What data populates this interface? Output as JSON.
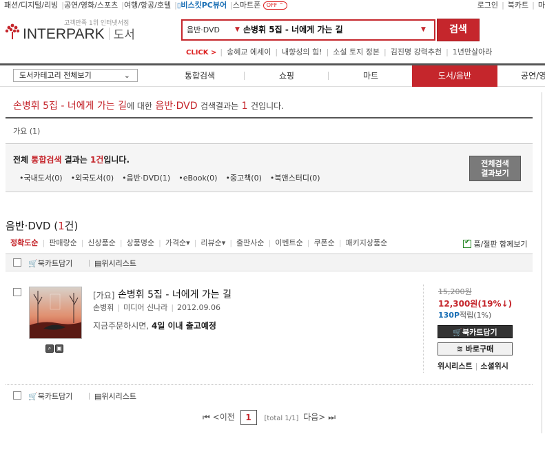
{
  "top_util": {
    "left_links": [
      "패션/디지털/리빙",
      "공연/영화/스포츠",
      "여행/항공/호텔"
    ],
    "biz_pc": "비스킷PC뷰어",
    "smart": "스마트폰",
    "off_badge": "OFF ⌃",
    "right_links": [
      "로그인",
      "북카트",
      "마"
    ]
  },
  "logo": {
    "tagline": "고객만족 1위 인터넷서점",
    "brand": "INTERPARK",
    "section": "도서"
  },
  "search": {
    "category": "음반·DVD",
    "query": "손병휘 5집 - 너에게 가는 길",
    "button": "검색"
  },
  "click_row": {
    "label": "CLICK >",
    "items": [
      "송혜교 에세이",
      "내향성의 힘!",
      "소설 토지 정본",
      "김진명 강력추천",
      "1년만살아라"
    ]
  },
  "gnb": {
    "category_select": "도서카테고리 전체보기",
    "tabs": [
      "통합검색",
      "쇼핑",
      "마트",
      "도서/음반",
      "공연/영"
    ],
    "active_tab": "도서/음반"
  },
  "result": {
    "query": "손병휘 5집 - 너에게 가는 길",
    "mid": "에 대한",
    "category": "음반·DVD",
    "tail1": "검색결과는",
    "count": "1",
    "tail2": "건입니다."
  },
  "genre_filter": "가요 (1)",
  "total": {
    "pre": "전체",
    "highlight": "통합검색",
    "mid": "결과는",
    "count": "1건",
    "post": "입니다.",
    "links": [
      "•국내도서(0)",
      "•외국도서(0)",
      "•음반·DVD(1)",
      "•eBook(0)",
      "•중고책(0)",
      "•북앤스터디(0)"
    ],
    "button_line1": "전체검색",
    "button_line2": "결과보기"
  },
  "section": {
    "title": "음반·DVD",
    "count_open": "(",
    "count": "1",
    "count_close": "건)"
  },
  "sort": {
    "items": [
      "정확도순",
      "판매량순",
      "신상품순",
      "상품명순",
      "가격순▾",
      "리뷰순▾",
      "출판사순",
      "이벤트순",
      "쿠폰순",
      "패키지상품순"
    ],
    "active": "정확도순",
    "combine_label": "품/절판 함께보기"
  },
  "actions": {
    "cart": "북카트담기",
    "wish": "위시리스트"
  },
  "item": {
    "genre": "[가요]",
    "title": "손병휘 5집 - 너에게 가는 길",
    "artist": "손병휘",
    "label": "미디어 신나라",
    "date": "2012.09.06",
    "ship_pre": "지금주문하시면,",
    "ship_bold": "4일 이내 출고예정",
    "price_orig": "15,200원",
    "price_sale": "12,300원(19%↓)",
    "point": "130P",
    "point_rest": "적립(1%)",
    "btn_cart": "북카트담기",
    "btn_buy": "바로구매",
    "wish1": "위시리스트",
    "wish2": "소셜위시"
  },
  "pager": {
    "first": "⏮",
    "prev": "<이전",
    "current": "1",
    "total": "[total 1/1]",
    "next": "다음>",
    "last": "⏭"
  },
  "colors": {
    "accent": "#c5262c",
    "point_blue": "#1a6fb5"
  }
}
